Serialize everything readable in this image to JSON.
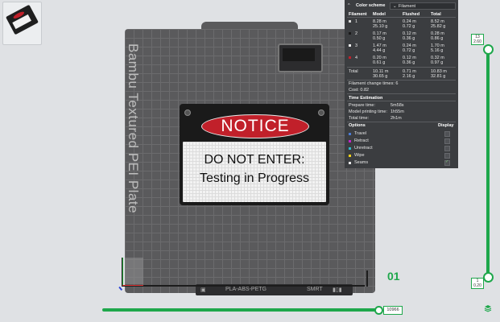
{
  "colors": {
    "accent": "#1ea74b",
    "panel_bg": "#3b3d40",
    "plate": "#5a5a5c",
    "notice_red": "#c1202a"
  },
  "plate": {
    "label": "Bambu Textured PEI Plate",
    "footer_text": "PLA-ABS-PETG",
    "footer_right": "SMRT",
    "number": "01"
  },
  "sign": {
    "header": "NOTICE",
    "line1": "DO NOT ENTER:",
    "line2": "Testing in Progress"
  },
  "panel": {
    "color_scheme_label": "Color scheme",
    "color_scheme_value": "Filament",
    "headers": {
      "filament": "Filament",
      "model": "Model",
      "flushed": "Flushed",
      "total": "Total"
    },
    "filaments": [
      {
        "id": "1",
        "color": "#d9d9d9",
        "model_m": "8.28 m",
        "model_g": "25.10 g",
        "flushed_m": "0.24 m",
        "flushed_g": "0.72 g",
        "total_m": "8.52 m",
        "total_g": "25.82 g"
      },
      {
        "id": "2",
        "color": "#1a1a1a",
        "model_m": "0.17 m",
        "model_g": "0.50 g",
        "flushed_m": "0.12 m",
        "flushed_g": "0.36 g",
        "total_m": "0.28 m",
        "total_g": "0.86 g"
      },
      {
        "id": "3",
        "color": "#f2f2f2",
        "model_m": "1.47 m",
        "model_g": "4.44 g",
        "flushed_m": "0.24 m",
        "flushed_g": "0.72 g",
        "total_m": "1.70 m",
        "total_g": "5.16 g"
      },
      {
        "id": "4",
        "color": "#c1202a",
        "model_m": "0.20 m",
        "model_g": "0.61 g",
        "flushed_m": "0.12 m",
        "flushed_g": "0.36 g",
        "total_m": "0.32 m",
        "total_g": "0.97 g"
      }
    ],
    "total": {
      "label": "Total",
      "model_m": "10.11 m",
      "model_g": "30.65 g",
      "flushed_m": "0.71 m",
      "flushed_g": "2.16 g",
      "total_m": "10.83 m",
      "total_g": "32.81 g"
    },
    "change_times": "Filament change times:  6",
    "cost": "Cost:  0.82",
    "time_header": "Time Estimation",
    "prepare_label": "Prepare time:",
    "prepare_value": "5m58s",
    "model_time_label": "Model printing time:",
    "model_time_value": "1h55m",
    "total_time_label": "Total time:",
    "total_time_value": "2h1m",
    "options_label": "Options",
    "display_label": "Display",
    "options": [
      {
        "label": "Travel",
        "color": "#4b7bd6",
        "checked": false
      },
      {
        "label": "Retract",
        "color": "#c026c9",
        "checked": false
      },
      {
        "label": "Unretract",
        "color": "#2fb7c9",
        "checked": false
      },
      {
        "label": "Wipe",
        "color": "#f2d21b",
        "checked": false
      },
      {
        "label": "Seams",
        "color": "#e8e8e8",
        "checked": true
      }
    ]
  },
  "layer_slider": {
    "top_layer": "13",
    "top_height": "2.60",
    "bottom_layer": "1",
    "bottom_height": "0.20"
  },
  "move_slider": {
    "value": "10966"
  }
}
